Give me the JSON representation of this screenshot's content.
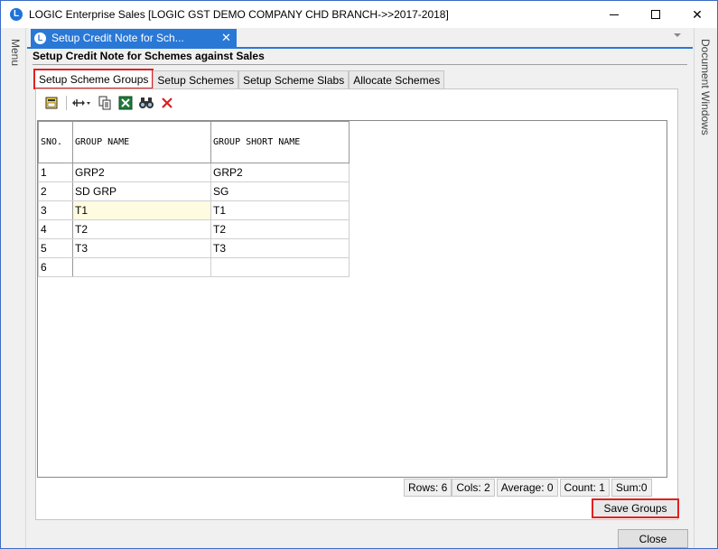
{
  "window": {
    "title": "LOGIC Enterprise Sales  [LOGIC GST DEMO COMPANY CHD BRANCH->>2017-2018]",
    "app_icon_letter": "L",
    "minimize_label": "—",
    "close_label": "✕"
  },
  "side": {
    "menu_label": "Menu",
    "docs_label": "Document Windows"
  },
  "doc_tab": {
    "label": "Setup Credit Note for Sch...",
    "close": "✕"
  },
  "page": {
    "heading": "Setup Credit Note for Schemes against Sales"
  },
  "subtabs": [
    {
      "label": "Setup Scheme Groups"
    },
    {
      "label": "Setup Schemes"
    },
    {
      "label": "Setup Scheme Slabs"
    },
    {
      "label": "Allocate Schemes"
    }
  ],
  "toolbar": {
    "icons": [
      "new-icon",
      "resize-columns-icon",
      "copy-icon",
      "excel-icon",
      "find-icon",
      "delete-icon"
    ]
  },
  "grid": {
    "columns": [
      "SNO.",
      "GROUP NAME",
      "GROUP SHORT NAME"
    ],
    "rows": [
      {
        "sno": "1",
        "name": "GRP2",
        "short": "GRP2"
      },
      {
        "sno": "2",
        "name": "SD GRP",
        "short": "SG"
      },
      {
        "sno": "3",
        "name": "T1",
        "short": "T1"
      },
      {
        "sno": "4",
        "name": "T2",
        "short": "T2"
      },
      {
        "sno": "5",
        "name": "T3",
        "short": "T3"
      },
      {
        "sno": "6",
        "name": "",
        "short": ""
      }
    ]
  },
  "status": {
    "rows": "Rows: 6",
    "cols": "Cols: 2",
    "average": "Average: 0",
    "count": "Count: 1",
    "sum": "Sum:0"
  },
  "buttons": {
    "save": "Save Groups",
    "close": "Close"
  },
  "colors": {
    "accent": "#2a78d6",
    "highlight_border": "#e02020"
  }
}
